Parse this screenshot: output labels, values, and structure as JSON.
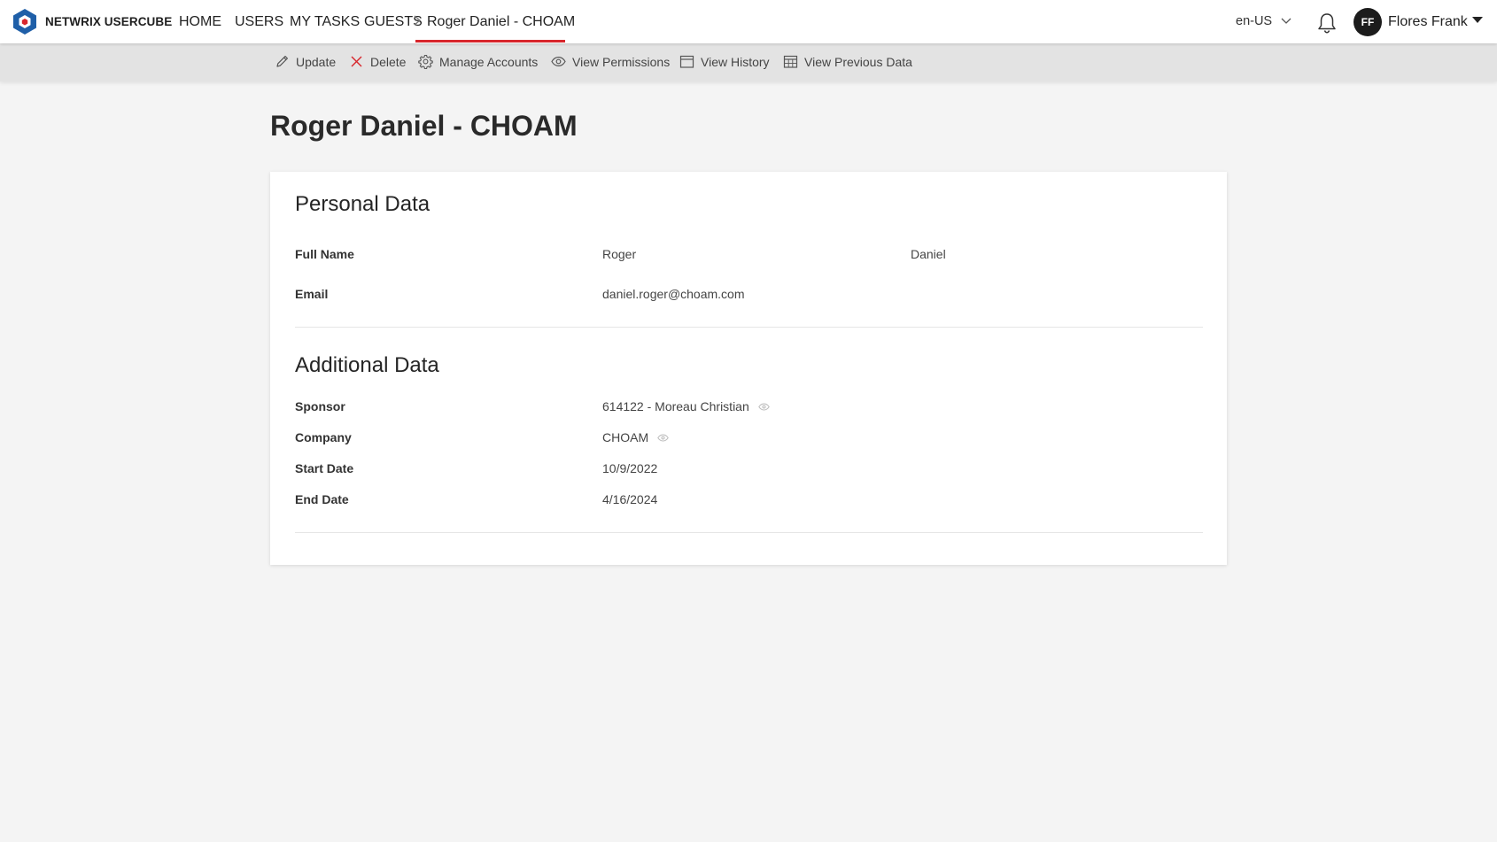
{
  "brand": {
    "name": "NETWRIX USERCUBE"
  },
  "nav": {
    "items": [
      "HOME",
      "USERS",
      "MY TASKS",
      "GUESTS"
    ],
    "current": "Roger Daniel - CHOAM"
  },
  "header": {
    "language": "en-US",
    "user_initials": "FF",
    "user_name": "Flores Frank"
  },
  "toolbar": {
    "update": "Update",
    "delete": "Delete",
    "manage_accounts": "Manage Accounts",
    "view_permissions": "View Permissions",
    "view_history": "View History",
    "view_previous_data": "View Previous Data"
  },
  "page": {
    "title": "Roger Daniel - CHOAM"
  },
  "personal": {
    "title": "Personal Data",
    "full_name_label": "Full Name",
    "first_name": "Roger",
    "last_name": "Daniel",
    "email_label": "Email",
    "email": "daniel.roger@choam.com"
  },
  "additional": {
    "title": "Additional Data",
    "sponsor_label": "Sponsor",
    "sponsor": "614122 - Moreau Christian",
    "company_label": "Company",
    "company": "CHOAM",
    "start_date_label": "Start Date",
    "start_date": "10/9/2022",
    "end_date_label": "End Date",
    "end_date": "4/16/2024"
  },
  "colors": {
    "accent": "#d8262c",
    "brand_blue": "#1f5fa8"
  }
}
